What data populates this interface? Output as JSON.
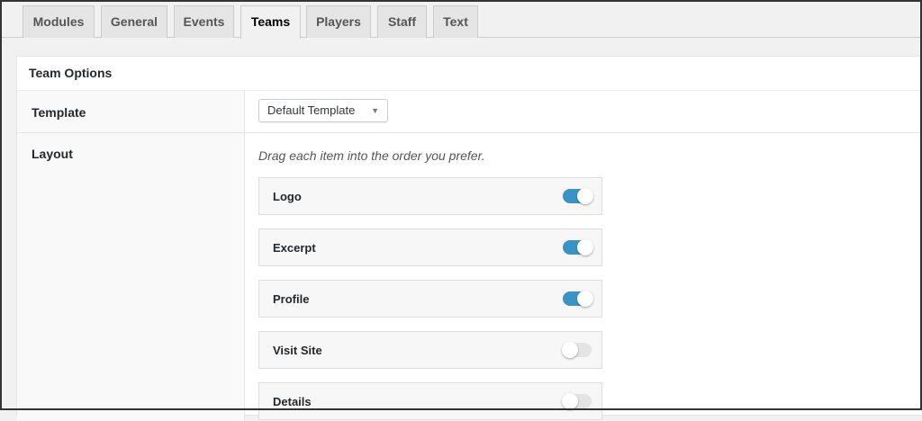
{
  "tabs": [
    {
      "label": "Modules",
      "active": false
    },
    {
      "label": "General",
      "active": false
    },
    {
      "label": "Events",
      "active": false
    },
    {
      "label": "Teams",
      "active": true
    },
    {
      "label": "Players",
      "active": false
    },
    {
      "label": "Staff",
      "active": false
    },
    {
      "label": "Text",
      "active": false
    }
  ],
  "panel": {
    "title": "Team Options",
    "template": {
      "label": "Template",
      "selected": "Default Template"
    },
    "layout": {
      "label": "Layout",
      "hint": "Drag each item into the order you prefer.",
      "items": [
        {
          "label": "Logo",
          "enabled": true
        },
        {
          "label": "Excerpt",
          "enabled": true
        },
        {
          "label": "Profile",
          "enabled": true
        },
        {
          "label": "Visit Site",
          "enabled": false
        },
        {
          "label": "Details",
          "enabled": false
        }
      ]
    }
  },
  "colors": {
    "toggle_on": "#3b92c5",
    "toggle_off": "#e4e4e4"
  },
  "icons": {
    "select_arrow": "triangle-down-icon"
  }
}
